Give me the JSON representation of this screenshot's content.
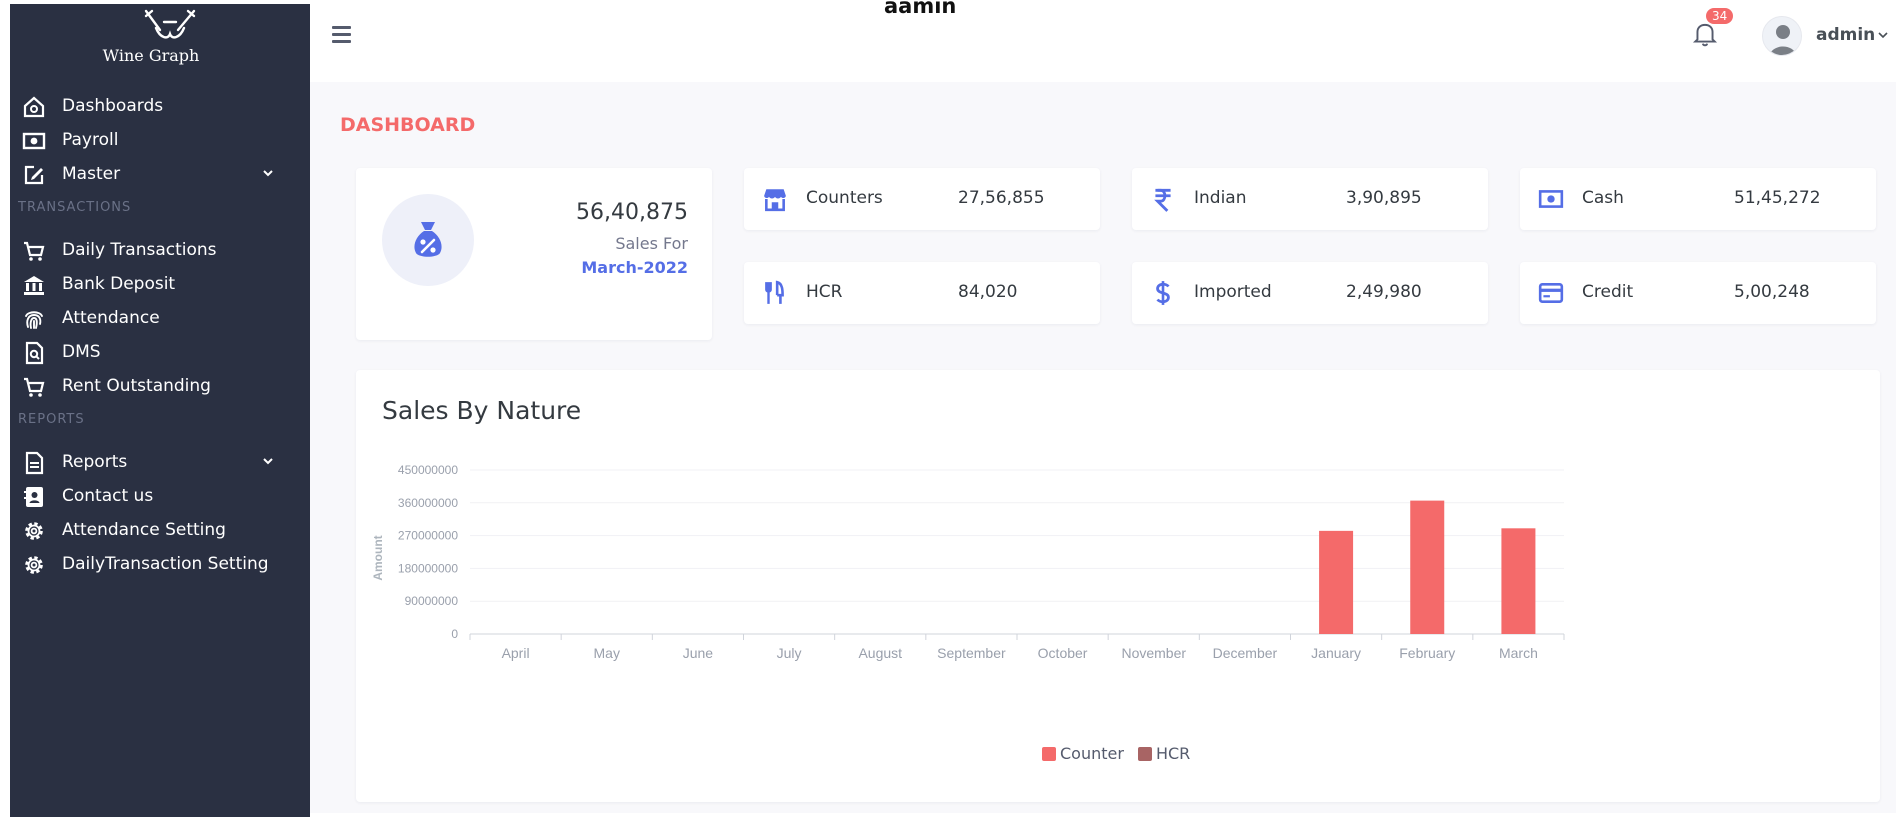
{
  "logo": {
    "text": "Wine Graph"
  },
  "sidebar": {
    "items_top": [
      {
        "label": "Dashboards",
        "icon": "home-icon"
      },
      {
        "label": "Payroll",
        "icon": "money-icon"
      },
      {
        "label": "Master",
        "icon": "edit-icon",
        "has_children": true
      }
    ],
    "section_transactions": "TRANSACTIONS",
    "items_transactions": [
      {
        "label": "Daily Transactions",
        "icon": "cart-icon"
      },
      {
        "label": "Bank Deposit",
        "icon": "bank-icon"
      },
      {
        "label": "Attendance",
        "icon": "fingerprint-icon"
      },
      {
        "label": "DMS",
        "icon": "file-search-icon"
      },
      {
        "label": "Rent Outstanding",
        "icon": "cart-icon"
      }
    ],
    "section_reports": "REPORTS",
    "items_reports": [
      {
        "label": "Reports",
        "icon": "file-icon",
        "has_children": true
      },
      {
        "label": "Contact us",
        "icon": "contact-icon"
      },
      {
        "label": "Attendance Setting",
        "icon": "gear-icon"
      },
      {
        "label": "DailyTransaction Setting",
        "icon": "gear-icon"
      }
    ]
  },
  "topbar": {
    "center_text": "aamin",
    "notification_count": "34",
    "user_name": "admin"
  },
  "page": {
    "title": "DASHBOARD"
  },
  "sales_card": {
    "value": "56,40,875",
    "label": "Sales For",
    "month": "March-2022"
  },
  "stats": [
    {
      "label": "Counters",
      "value": "27,56,855",
      "icon": "store-icon"
    },
    {
      "label": "Indian",
      "value": "3,90,895",
      "icon": "rupee-icon"
    },
    {
      "label": "Cash",
      "value": "51,45,272",
      "icon": "money-icon"
    },
    {
      "label": "HCR",
      "value": "84,020",
      "icon": "restaurant-icon"
    },
    {
      "label": "Imported",
      "value": "2,49,980",
      "icon": "dollar-icon"
    },
    {
      "label": "Credit",
      "value": "5,00,248",
      "icon": "credit-card-icon"
    }
  ],
  "colors": {
    "sidebar_bg": "#2a3042",
    "accent": "#556ee6",
    "danger": "#f46a6a",
    "counter_series": "#f46a6a",
    "hcr_series": "#a86464"
  },
  "chart_data": {
    "type": "bar",
    "title": "Sales By Nature",
    "ylabel": "Amount",
    "xlabel": "",
    "ylim": [
      0,
      450000000
    ],
    "yticks": [
      0,
      90000000,
      180000000,
      270000000,
      360000000,
      450000000
    ],
    "categories": [
      "April",
      "May",
      "June",
      "July",
      "August",
      "September",
      "October",
      "November",
      "December",
      "January",
      "February",
      "March"
    ],
    "series": [
      {
        "name": "Counter",
        "values": [
          0,
          0,
          0,
          0,
          0,
          0,
          0,
          0,
          0,
          283000000,
          366000000,
          290000000
        ]
      },
      {
        "name": "HCR",
        "values": [
          0,
          0,
          0,
          0,
          0,
          0,
          0,
          0,
          0,
          0,
          0,
          0
        ]
      }
    ],
    "grid": true,
    "legend_position": "bottom-center"
  }
}
